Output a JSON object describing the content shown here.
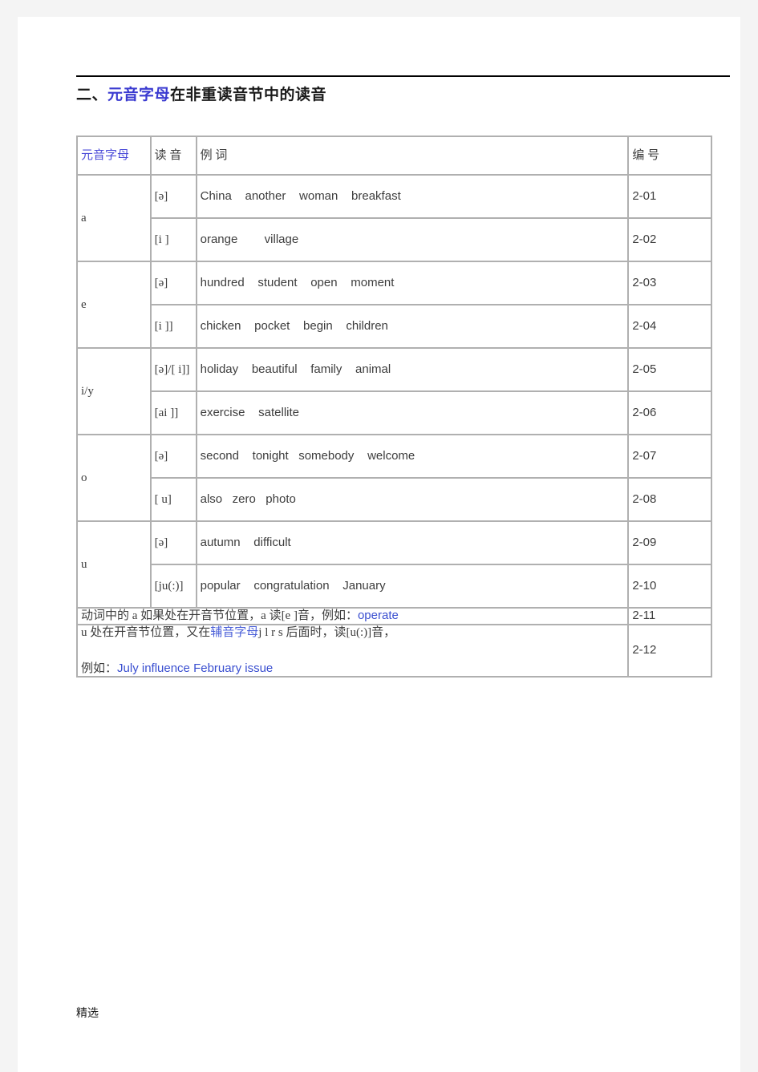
{
  "document": {
    "title_prefix": "二、",
    "title_highlight": "元音字母",
    "title_suffix": "在非重读音节中的读音",
    "footer_mark": "精选"
  },
  "table": {
    "headers": {
      "vowel_letter": "元音字母",
      "pronunciation": "读 音",
      "example_words": "例 词",
      "number": "编 号"
    },
    "rows": [
      {
        "letter": "a",
        "phonetic": "[ə]",
        "words": "China    another    woman    breakfast",
        "number": "2-01"
      },
      {
        "letter": "",
        "phonetic": "[i ]",
        "words": "orange        village",
        "number": "2-02"
      },
      {
        "letter": "e",
        "phonetic": "[ə]",
        "words": "hundred    student    open    moment",
        "number": "2-03"
      },
      {
        "letter": "",
        "phonetic": "[i ]]",
        "words": "chicken    pocket    begin    children",
        "number": "2-04"
      },
      {
        "letter": "i/y",
        "phonetic": "[ə]/[ i]]",
        "words": "holiday    beautiful    family    animal",
        "number": "2-05"
      },
      {
        "letter": "",
        "phonetic": "[ai ]]",
        "words": "exercise    satellite",
        "number": "2-06"
      },
      {
        "letter": "o",
        "phonetic": "[ə]",
        "words": "second    tonight   somebody    welcome",
        "number": "2-07"
      },
      {
        "letter": "",
        "phonetic": "[ u]",
        "words": "also   zero   photo",
        "number": "2-08"
      },
      {
        "letter": "u",
        "phonetic": "[ə]",
        "words": "autumn    difficult",
        "number": "2-09"
      },
      {
        "letter": "",
        "phonetic": "[ju(:)]",
        "words": "popular    congratulation    January",
        "number": "2-10"
      }
    ],
    "notes": [
      {
        "number": "2-11",
        "segments": [
          {
            "text": "动词中的 a 如果处在开音节位置，a 读[e ]音，例如：",
            "style": "plain"
          },
          {
            "text": "operate",
            "style": "blue"
          }
        ]
      },
      {
        "number": "2-12",
        "line1_segments": [
          {
            "text": "u 处在开音节位置，又在",
            "style": "plain"
          },
          {
            "text": "辅音字母",
            "style": "cn-blue"
          },
          {
            "text": "j l r s 后面时，读[u(:)]音，",
            "style": "plain"
          }
        ],
        "line2_segments": [
          {
            "text": "例如：",
            "style": "plain"
          },
          {
            "text": "July influence February issue",
            "style": "blue"
          }
        ]
      }
    ]
  },
  "colors": {
    "accent_blue": "#3a4fd0",
    "heading_blue": "#4a4ad8",
    "text_dark": "#3d3d3d",
    "border_gray": "#b0b0b0"
  }
}
